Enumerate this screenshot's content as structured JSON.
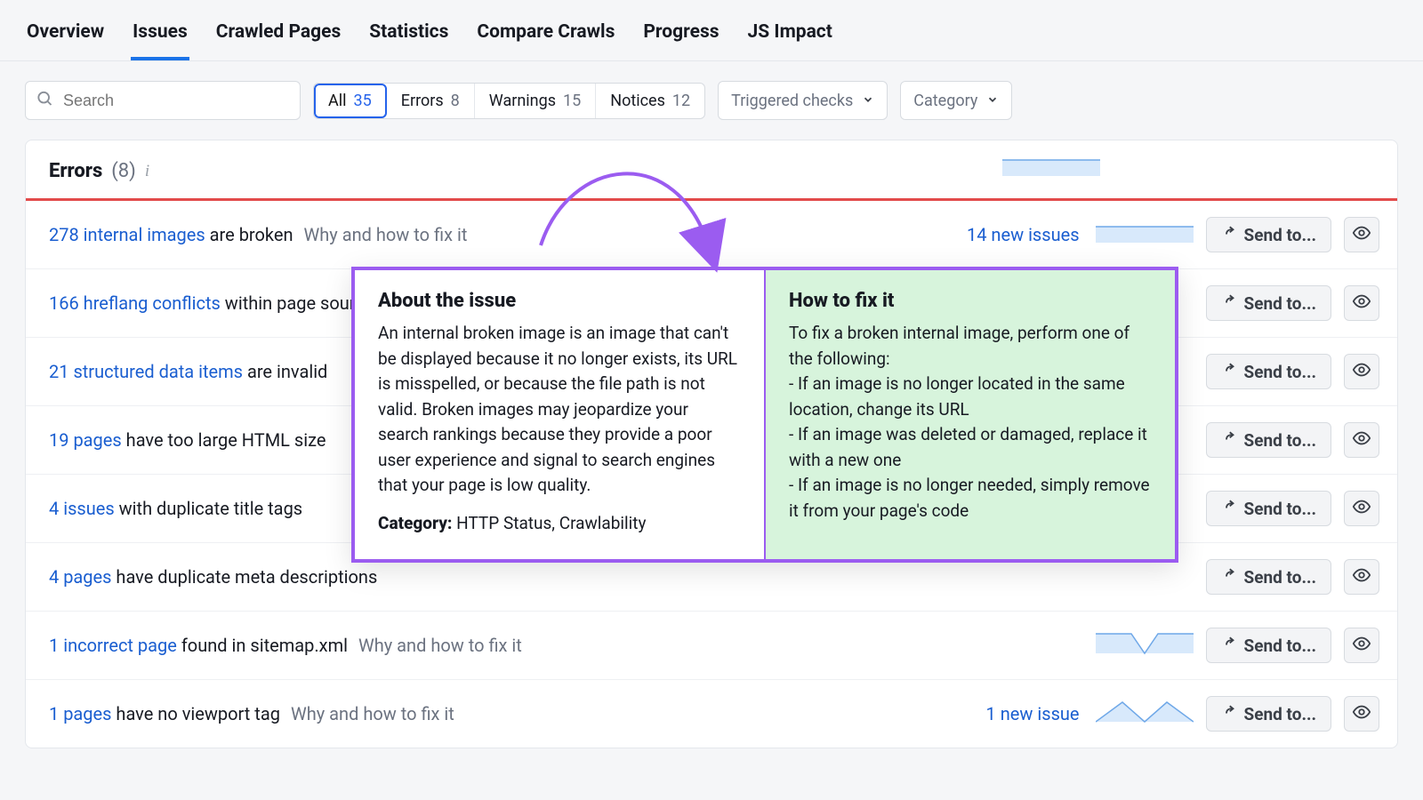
{
  "tabs": {
    "overview": "Overview",
    "issues": "Issues",
    "crawled": "Crawled Pages",
    "statistics": "Statistics",
    "compare": "Compare Crawls",
    "progress": "Progress",
    "jsimpact": "JS Impact"
  },
  "filters": {
    "search_placeholder": "Search",
    "all_label": "All",
    "all_count": "35",
    "errors_label": "Errors",
    "errors_count": "8",
    "warnings_label": "Warnings",
    "warnings_count": "15",
    "notices_label": "Notices",
    "notices_count": "12",
    "triggered_label": "Triggered checks",
    "category_label": "Category"
  },
  "section": {
    "title": "Errors",
    "count": "(8)"
  },
  "why_fix": "Why and how to fix it",
  "send_to": "Send to...",
  "rows": [
    {
      "link": "278 internal images",
      "suffix": " are broken",
      "new": "14 new issues",
      "show_fix": true,
      "spark": "flat"
    },
    {
      "link": "166 hreflang conflicts",
      "suffix": " within page source code",
      "new": "",
      "show_fix": false,
      "spark": ""
    },
    {
      "link": "21 structured data items",
      "suffix": " are invalid",
      "new": "",
      "show_fix": false,
      "spark": ""
    },
    {
      "link": "19 pages",
      "suffix": " have too large HTML size",
      "new": "",
      "show_fix": false,
      "spark": ""
    },
    {
      "link": "4 issues",
      "suffix": " with duplicate title tags",
      "new": "",
      "show_fix": false,
      "spark": ""
    },
    {
      "link": "4 pages",
      "suffix": " have duplicate meta descriptions",
      "new": "",
      "show_fix": false,
      "spark": ""
    },
    {
      "link": "1 incorrect page",
      "suffix": " found in sitemap.xml",
      "new": "",
      "show_fix": true,
      "spark": "vflat"
    },
    {
      "link": "1 pages",
      "suffix": " have no viewport tag",
      "new": "1 new issue",
      "show_fix": true,
      "spark": "zig"
    }
  ],
  "popover": {
    "about_title": "About the issue",
    "about_body": "An internal broken image is an image that can't be displayed because it no longer exists, its URL is misspelled, or because the file path is not valid. Broken images may jeopardize your search rankings because they provide a poor user experience and signal to search engines that your page is low quality.",
    "category_label": "Category:",
    "category_value": " HTTP Status, Crawlability",
    "fix_title": "How to fix it",
    "fix_body": "To fix a broken internal image, perform one of the following:\n- If an image is no longer located in the same location, change its URL\n- If an image was deleted or damaged, replace it with a new one\n- If an image is no longer needed, simply remove it from your page's code"
  }
}
